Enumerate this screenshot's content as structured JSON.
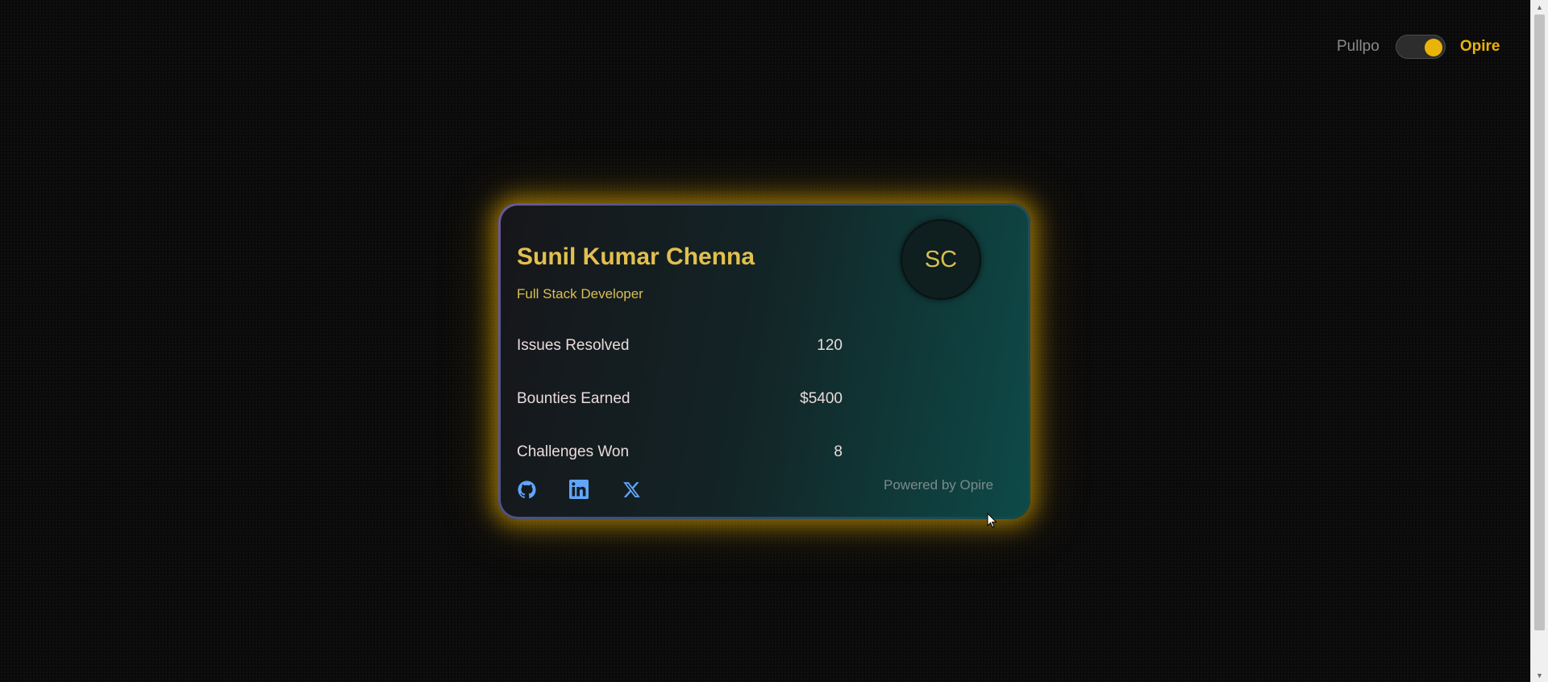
{
  "theme": {
    "accent": "#eab308",
    "card_name_color": "#e2c04e",
    "icon_color": "#60a5fa"
  },
  "toggle": {
    "left_label": "Pullpo",
    "right_label": "Opire",
    "active": "Opire"
  },
  "card": {
    "name": "Sunil Kumar Chenna",
    "role": "Full Stack Developer",
    "avatar_initials": "SC",
    "stats": [
      {
        "label": "Issues Resolved",
        "value": "120"
      },
      {
        "label": "Bounties Earned",
        "value": "$5400"
      },
      {
        "label": "Challenges Won",
        "value": "8"
      }
    ],
    "socials": [
      {
        "icon": "github-icon"
      },
      {
        "icon": "linkedin-icon"
      },
      {
        "icon": "x-twitter-icon"
      }
    ],
    "footer": "Powered by Opire"
  }
}
